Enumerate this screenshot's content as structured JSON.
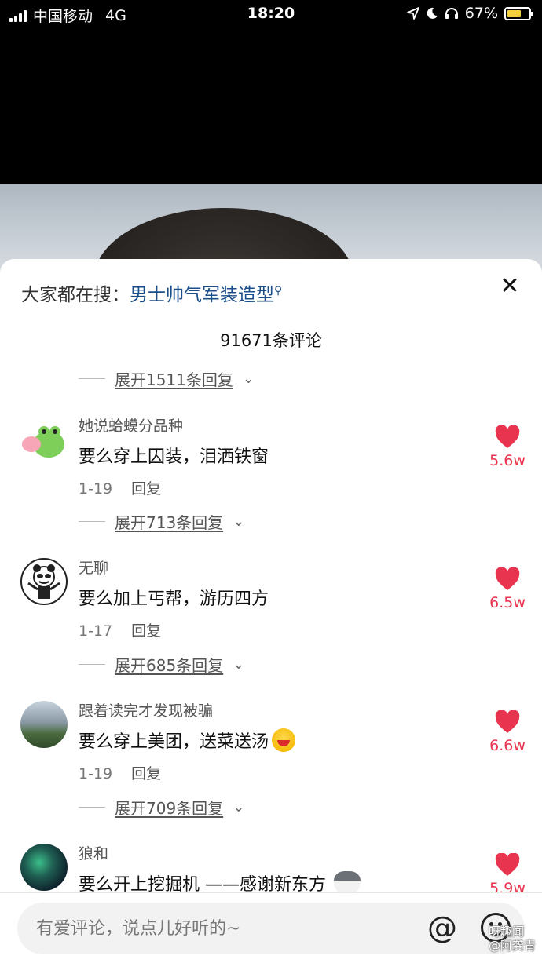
{
  "status_bar": {
    "carrier": "中国移动",
    "network": "4G",
    "time": "18:20",
    "battery": "67%",
    "battery_level": 0.67,
    "icons": [
      "location-icon",
      "moon-icon",
      "headphones-icon",
      "battery-icon"
    ]
  },
  "search": {
    "prefix": "大家都在搜：",
    "keyword": "男士帅气军装造型"
  },
  "comments_count": "91671条评论",
  "expand_top": "展开1511条回复",
  "comments": [
    {
      "user": "她说蛤蟆分品种",
      "text": "要么穿上囚装，泪洒铁窗",
      "date": "1-19",
      "reply": "回复",
      "likes": "5.6w",
      "expand": "展开713条回复"
    },
    {
      "user": "无聊",
      "text": "要么加上丐帮，游历四方",
      "date": "1-17",
      "reply": "回复",
      "likes": "6.5w",
      "expand": "展开685条回复"
    },
    {
      "user": "跟着读完才发现被骗",
      "text": "要么穿上美团，送菜送汤",
      "date": "1-19",
      "reply": "回复",
      "likes": "6.6w",
      "expand": "展开709条回复"
    },
    {
      "user": "狼和",
      "text": "要么开上挖掘机 ——感谢新东方",
      "likes": "5.9w"
    }
  ],
  "input": {
    "placeholder": "有爱评论，说点儿好听的~"
  },
  "watermark": {
    "line1": "呀趣闻",
    "line2": "@阿龚青"
  },
  "colors": {
    "accent_heart": "#e8344e",
    "keyword_link": "#1a4e8a"
  }
}
